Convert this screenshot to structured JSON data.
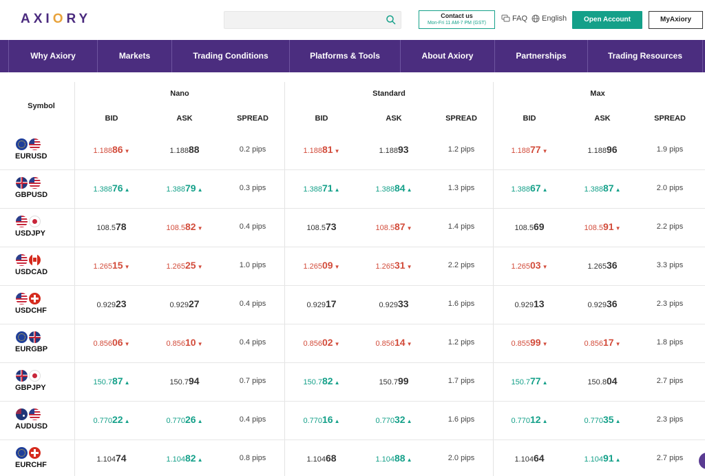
{
  "header": {
    "logo": "AXI RY",
    "logo_parts": [
      "AXI",
      "O",
      "RY"
    ],
    "contact_title": "Contact us",
    "contact_hours": "Mon-Fri 11 AM-7 PM (GST)",
    "faq": "FAQ",
    "language": "English",
    "open_account": "Open Account",
    "my_axiory": "MyAxiory"
  },
  "nav": [
    "Why Axiory",
    "Markets",
    "Trading Conditions",
    "Platforms & Tools",
    "About Axiory",
    "Partnerships",
    "Trading Resources"
  ],
  "table": {
    "symbol_header": "Symbol",
    "groups": [
      "Nano",
      "Standard",
      "Max"
    ],
    "columns": [
      "BID",
      "ASK",
      "SPREAD"
    ],
    "rows": [
      {
        "symbol": "EURUSD",
        "flags": [
          "eu",
          "us"
        ],
        "cells": [
          {
            "pre": "1.188",
            "big": "86",
            "dir": "down"
          },
          {
            "pre": "1.188",
            "big": "88",
            "dir": "none"
          },
          {
            "text": "0.2 pips"
          },
          {
            "pre": "1.188",
            "big": "81",
            "dir": "down"
          },
          {
            "pre": "1.188",
            "big": "93",
            "dir": "none"
          },
          {
            "text": "1.2 pips"
          },
          {
            "pre": "1.188",
            "big": "77",
            "dir": "down"
          },
          {
            "pre": "1.188",
            "big": "96",
            "dir": "none"
          },
          {
            "text": "1.9 pips"
          }
        ]
      },
      {
        "symbol": "GBPUSD",
        "flags": [
          "gb",
          "us"
        ],
        "cells": [
          {
            "pre": "1.388",
            "big": "76",
            "dir": "up"
          },
          {
            "pre": "1.388",
            "big": "79",
            "dir": "up"
          },
          {
            "text": "0.3 pips"
          },
          {
            "pre": "1.388",
            "big": "71",
            "dir": "up"
          },
          {
            "pre": "1.388",
            "big": "84",
            "dir": "up"
          },
          {
            "text": "1.3 pips"
          },
          {
            "pre": "1.388",
            "big": "67",
            "dir": "up"
          },
          {
            "pre": "1.388",
            "big": "87",
            "dir": "up"
          },
          {
            "text": "2.0 pips"
          }
        ]
      },
      {
        "symbol": "USDJPY",
        "flags": [
          "us",
          "jp"
        ],
        "cells": [
          {
            "pre": "108.5",
            "big": "78",
            "dir": "none"
          },
          {
            "pre": "108.5",
            "big": "82",
            "dir": "down"
          },
          {
            "text": "0.4 pips"
          },
          {
            "pre": "108.5",
            "big": "73",
            "dir": "none"
          },
          {
            "pre": "108.5",
            "big": "87",
            "dir": "down"
          },
          {
            "text": "1.4 pips"
          },
          {
            "pre": "108.5",
            "big": "69",
            "dir": "none"
          },
          {
            "pre": "108.5",
            "big": "91",
            "dir": "down"
          },
          {
            "text": "2.2 pips"
          }
        ]
      },
      {
        "symbol": "USDCAD",
        "flags": [
          "us",
          "ca"
        ],
        "cells": [
          {
            "pre": "1.265",
            "big": "15",
            "dir": "down"
          },
          {
            "pre": "1.265",
            "big": "25",
            "dir": "down"
          },
          {
            "text": "1.0 pips"
          },
          {
            "pre": "1.265",
            "big": "09",
            "dir": "down"
          },
          {
            "pre": "1.265",
            "big": "31",
            "dir": "down"
          },
          {
            "text": "2.2 pips"
          },
          {
            "pre": "1.265",
            "big": "03",
            "dir": "down"
          },
          {
            "pre": "1.265",
            "big": "36",
            "dir": "none"
          },
          {
            "text": "3.3 pips"
          }
        ]
      },
      {
        "symbol": "USDCHF",
        "flags": [
          "us",
          "ch"
        ],
        "cells": [
          {
            "pre": "0.929",
            "big": "23",
            "dir": "none"
          },
          {
            "pre": "0.929",
            "big": "27",
            "dir": "none"
          },
          {
            "text": "0.4 pips"
          },
          {
            "pre": "0.929",
            "big": "17",
            "dir": "none"
          },
          {
            "pre": "0.929",
            "big": "33",
            "dir": "none"
          },
          {
            "text": "1.6 pips"
          },
          {
            "pre": "0.929",
            "big": "13",
            "dir": "none"
          },
          {
            "pre": "0.929",
            "big": "36",
            "dir": "none"
          },
          {
            "text": "2.3 pips"
          }
        ]
      },
      {
        "symbol": "EURGBP",
        "flags": [
          "eu",
          "gb"
        ],
        "cells": [
          {
            "pre": "0.856",
            "big": "06",
            "dir": "down"
          },
          {
            "pre": "0.856",
            "big": "10",
            "dir": "down"
          },
          {
            "text": "0.4 pips"
          },
          {
            "pre": "0.856",
            "big": "02",
            "dir": "down"
          },
          {
            "pre": "0.856",
            "big": "14",
            "dir": "down"
          },
          {
            "text": "1.2 pips"
          },
          {
            "pre": "0.855",
            "big": "99",
            "dir": "down"
          },
          {
            "pre": "0.856",
            "big": "17",
            "dir": "down"
          },
          {
            "text": "1.8 pips"
          }
        ]
      },
      {
        "symbol": "GBPJPY",
        "flags": [
          "gb",
          "jp"
        ],
        "cells": [
          {
            "pre": "150.7",
            "big": "87",
            "dir": "up"
          },
          {
            "pre": "150.7",
            "big": "94",
            "dir": "none"
          },
          {
            "text": "0.7 pips"
          },
          {
            "pre": "150.7",
            "big": "82",
            "dir": "up"
          },
          {
            "pre": "150.7",
            "big": "99",
            "dir": "none"
          },
          {
            "text": "1.7 pips"
          },
          {
            "pre": "150.7",
            "big": "77",
            "dir": "up"
          },
          {
            "pre": "150.8",
            "big": "04",
            "dir": "none"
          },
          {
            "text": "2.7 pips"
          }
        ]
      },
      {
        "symbol": "AUDUSD",
        "flags": [
          "au",
          "us"
        ],
        "cells": [
          {
            "pre": "0.770",
            "big": "22",
            "dir": "up"
          },
          {
            "pre": "0.770",
            "big": "26",
            "dir": "up"
          },
          {
            "text": "0.4 pips"
          },
          {
            "pre": "0.770",
            "big": "16",
            "dir": "up"
          },
          {
            "pre": "0.770",
            "big": "32",
            "dir": "up"
          },
          {
            "text": "1.6 pips"
          },
          {
            "pre": "0.770",
            "big": "12",
            "dir": "up"
          },
          {
            "pre": "0.770",
            "big": "35",
            "dir": "up"
          },
          {
            "text": "2.3 pips"
          }
        ]
      },
      {
        "symbol": "EURCHF",
        "flags": [
          "eu",
          "ch"
        ],
        "cells": [
          {
            "pre": "1.104",
            "big": "74",
            "dir": "none"
          },
          {
            "pre": "1.104",
            "big": "82",
            "dir": "up"
          },
          {
            "text": "0.8 pips"
          },
          {
            "pre": "1.104",
            "big": "68",
            "dir": "none"
          },
          {
            "pre": "1.104",
            "big": "88",
            "dir": "up"
          },
          {
            "text": "2.0 pips"
          },
          {
            "pre": "1.104",
            "big": "64",
            "dir": "none"
          },
          {
            "pre": "1.104",
            "big": "91",
            "dir": "up"
          },
          {
            "text": "2.7 pips"
          }
        ]
      }
    ]
  },
  "colors": {
    "brand_purple": "#4b2d7f",
    "accent_green": "#14a089",
    "down_red": "#d24b3a",
    "logo_orange": "#e8a33c"
  },
  "icons": [
    "search-icon",
    "faq-icon",
    "globe-icon",
    "arrow-up-icon",
    "arrow-down-icon",
    "chat-icon"
  ]
}
